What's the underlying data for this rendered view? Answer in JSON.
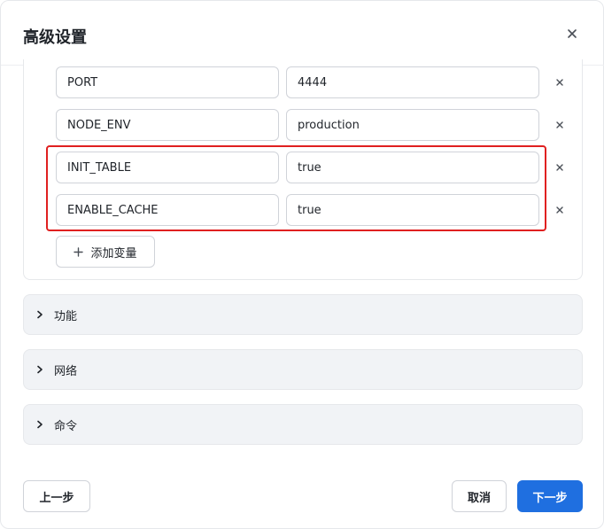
{
  "dialog": {
    "title": "高级设置"
  },
  "env_vars": [
    {
      "key": "PORT",
      "value": "4444"
    },
    {
      "key": "NODE_ENV",
      "value": "production"
    },
    {
      "key": "INIT_TABLE",
      "value": "true"
    },
    {
      "key": "ENABLE_CACHE",
      "value": "true"
    }
  ],
  "add_variable_label": "添加变量",
  "sections": [
    {
      "label": "功能"
    },
    {
      "label": "网络"
    },
    {
      "label": "命令"
    }
  ],
  "footer": {
    "prev_label": "上一步",
    "cancel_label": "取消",
    "next_label": "下一步"
  },
  "colors": {
    "primary": "#1f6fe0",
    "highlight": "#e02020"
  }
}
